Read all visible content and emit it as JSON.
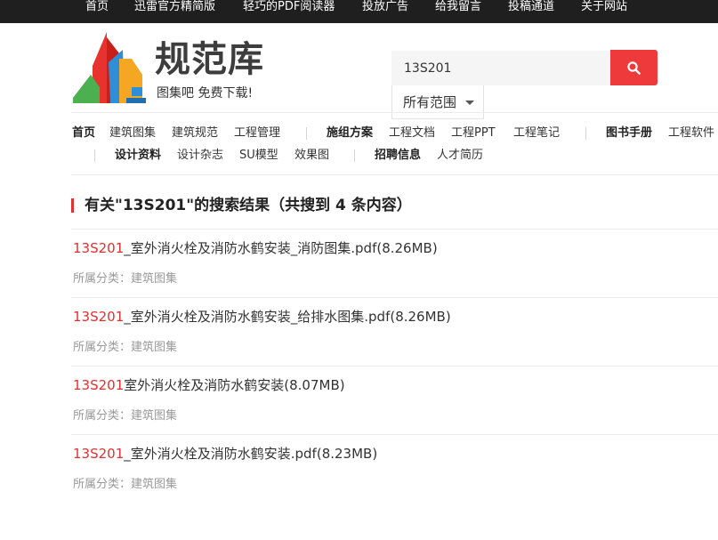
{
  "topnav": {
    "items": [
      "首页",
      "迅雷官方精简版",
      "轻巧的PDF阅读器",
      "投放广告",
      "给我留言",
      "投稿通道",
      "关于网站"
    ]
  },
  "logo": {
    "name": "规范库",
    "slogan": "图集吧 免费下载!",
    "colors": [
      "#e8322d",
      "#2e8fd8",
      "#f5a623",
      "#4caf50"
    ]
  },
  "search": {
    "value": "13S201",
    "scope_label": "所有范围",
    "button_color": "#ee3a3a"
  },
  "nav": {
    "row1": [
      "首页",
      "建筑图集",
      "建筑规范",
      "工程管理",
      "施组方案",
      "工程文档",
      "工程PPT",
      "工程笔记",
      "图书手册",
      "工程软件"
    ],
    "row2": [
      "设计资料",
      "设计杂志",
      "SU模型",
      "效果图",
      "招聘信息",
      "人才简历"
    ]
  },
  "results_header": {
    "title": "有关\"13S201\"的搜索结果（共搜到 4 条内容）"
  },
  "results": [
    {
      "keyword": "13S201",
      "title_rest": "_室外消火栓及消防水鹤安装_消防图集.pdf(8.26MB)",
      "category_label": "所属分类：",
      "category": "建筑图集"
    },
    {
      "keyword": "13S201",
      "title_rest": "_室外消火栓及消防水鹤安装_给排水图集.pdf(8.26MB)",
      "category_label": "所属分类：",
      "category": "建筑图集"
    },
    {
      "keyword": "13S201",
      "title_rest": "室外消火栓及消防水鹤安装(8.07MB)",
      "category_label": "所属分类：",
      "category": "建筑图集"
    },
    {
      "keyword": "13S201",
      "title_rest": "_室外消火栓及消防水鹤安装.pdf(8.23MB)",
      "category_label": "所属分类：",
      "category": "建筑图集"
    }
  ],
  "colors": {
    "topbar_bg": "#1f1f1f",
    "accent_red": "#e03131"
  }
}
